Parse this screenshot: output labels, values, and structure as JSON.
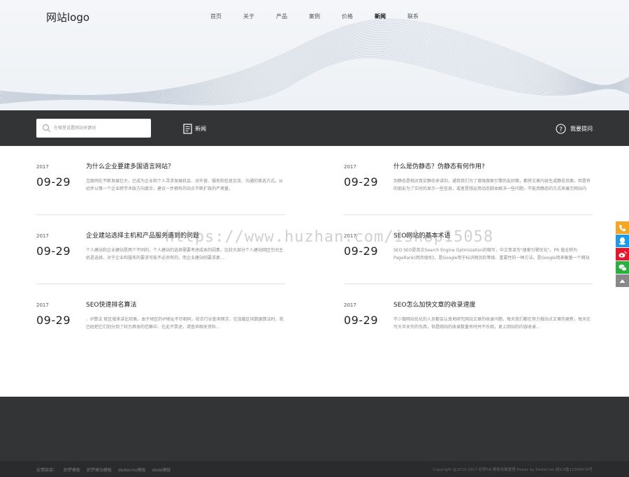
{
  "header": {
    "logo": "网站logo",
    "nav": [
      {
        "label": "首页",
        "active": false
      },
      {
        "label": "关于",
        "active": false
      },
      {
        "label": "产品",
        "active": false
      },
      {
        "label": "案例",
        "active": false
      },
      {
        "label": "价格",
        "active": false
      },
      {
        "label": "新闻",
        "active": true
      },
      {
        "label": "联系",
        "active": false
      }
    ]
  },
  "toolbar": {
    "search_placeholder": "在哪里设置网站关键词",
    "news_label": "新闻",
    "help_label": "我要提问",
    "icons": {
      "search": "search-icon",
      "news": "document-icon",
      "help": "question-circle-icon"
    }
  },
  "articles": [
    {
      "year": "2017",
      "date": "09-29",
      "title": "为什么企业要建多国语言网站？",
      "summary": "互联网在不断发展壮大，已成为企业和个人寻求发展机会、对外营、服务和信息交流、沟通的首选方式。从初步以策一个企业跨学术政方向度合，建议一步拥有的站点不断扩政的严肃量。"
    },
    {
      "year": "2017",
      "date": "09-29",
      "title": "什么是伪静态？伪静态有何作用?",
      "summary": "伪静态是相对真实静态来讲的，通常我们为了增强搜索引擎的友好面，都将文章内容生成静态页面，但是有的朋友为了实时的显示一些信息，或者是想运用动态脚本解决一些问题，不能用静态的方式来展示网站内容..."
    },
    {
      "year": "2017",
      "date": "09-29",
      "title": "企业建站选择主机和产品服务遇到的问题",
      "summary": "个人建站和企业建站是两个不同的，个人建站的选择需要考虑成本的因素，比较大部分个人建站网区空间主机是选择，对于企业和服务的要求可能不必须有的，而企业建站则要求更...."
    },
    {
      "year": "2017",
      "date": "09-29",
      "title": "SEO网站的基本术语",
      "summary": "SEO SEO是英文Search Engine Optimization的缩写，中文意译为\"搜索引擎优化\"。PR 值全称为PageRank(网页级别)，是Google用于标识网页的等级、重要性的一种方法，是Google用来衡量一个网站的好坏的唯一标准。"
    },
    {
      "year": "2017",
      "date": "09-29",
      "title": "SEO快速排名算法",
      "summary": "、IP算法 就区域来讲比较高，由于地区的IP地址不尽相同，综合行业查询频次，在加载区块数据算法时，就已经把它们划分到了较为具体的范畴中，在此不赘述，请查询相关资料..."
    },
    {
      "year": "2017",
      "date": "09-29",
      "title": "SEO怎么加快文章的收录速度",
      "summary": "不少做网站优化的人员都会认真地研究网站文章的收录问题，每天我们都在努力做站点文章的更新，每天在写大半天写的东西，但是网站的收录数量有时并不乐观，更上网站的内容收录..."
    }
  ],
  "watermark": "https://www.huzhan.com/ishop15058",
  "side_buttons": [
    {
      "icon": "phone-icon",
      "color": "#f5a623"
    },
    {
      "icon": "qq-icon",
      "color": "#1e9be6"
    },
    {
      "icon": "weibo-icon",
      "color": "#e6162d"
    },
    {
      "icon": "wechat-icon",
      "color": "#2bb03f"
    },
    {
      "icon": "back-to-top-icon",
      "color": "#888888"
    }
  ],
  "footer": {
    "links": [
      "友情链接：",
      "织梦模板",
      "织梦建站模板",
      "dedecms模板",
      "dede模板"
    ],
    "copyright": "Copyright @2010-2017 织梦58 模板收集整理 Power by DedeCms 赣ICP备12345678号"
  }
}
